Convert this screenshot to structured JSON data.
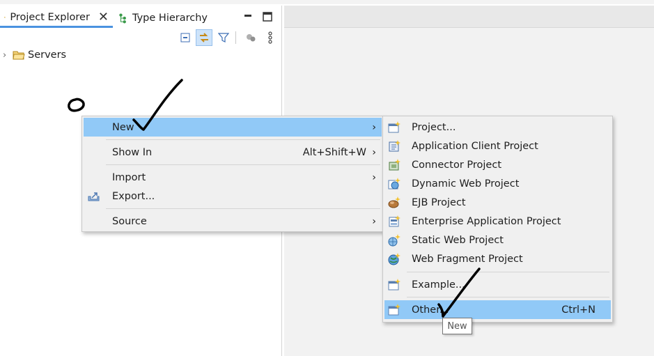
{
  "explorer": {
    "tabs": [
      {
        "label": "Project Explorer",
        "icon": "project-explorer-icon",
        "active": true
      },
      {
        "label": "Type Hierarchy",
        "icon": "type-hierarchy-icon",
        "active": false
      }
    ],
    "tree": [
      {
        "label": "Servers",
        "icon": "folder-icon",
        "expanded": false
      }
    ]
  },
  "context_menu": {
    "items": [
      {
        "label": "New",
        "highlighted": true,
        "submenu": true
      },
      {
        "label": "Show In",
        "accelerator": "Alt+Shift+W",
        "submenu": true
      },
      {
        "label": "Import",
        "submenu": true
      },
      {
        "label": "Export...",
        "icon": "export-icon"
      },
      {
        "label": "Source",
        "submenu": true
      }
    ]
  },
  "new_submenu": {
    "items": [
      {
        "label": "Project...",
        "icon": "new-project-icon"
      },
      {
        "label": "Application Client Project",
        "icon": "app-client-project-icon"
      },
      {
        "label": "Connector Project",
        "icon": "connector-project-icon"
      },
      {
        "label": "Dynamic Web Project",
        "icon": "dynamic-web-project-icon"
      },
      {
        "label": "EJB Project",
        "icon": "ejb-project-icon"
      },
      {
        "label": "Enterprise Application Project",
        "icon": "enterprise-app-project-icon"
      },
      {
        "label": "Static Web Project",
        "icon": "static-web-project-icon"
      },
      {
        "label": "Web Fragment Project",
        "icon": "web-fragment-project-icon"
      },
      {
        "label": "Example...",
        "icon": "example-icon"
      },
      {
        "label": "Other...",
        "accelerator": "Ctrl+N",
        "highlighted": true,
        "icon": "other-wizard-icon"
      }
    ]
  },
  "tooltip": {
    "text": "New"
  },
  "colors": {
    "highlight": "#91c9f7",
    "menu_bg": "#f0f0f0",
    "active_tab_underline": "#4a92e0"
  }
}
